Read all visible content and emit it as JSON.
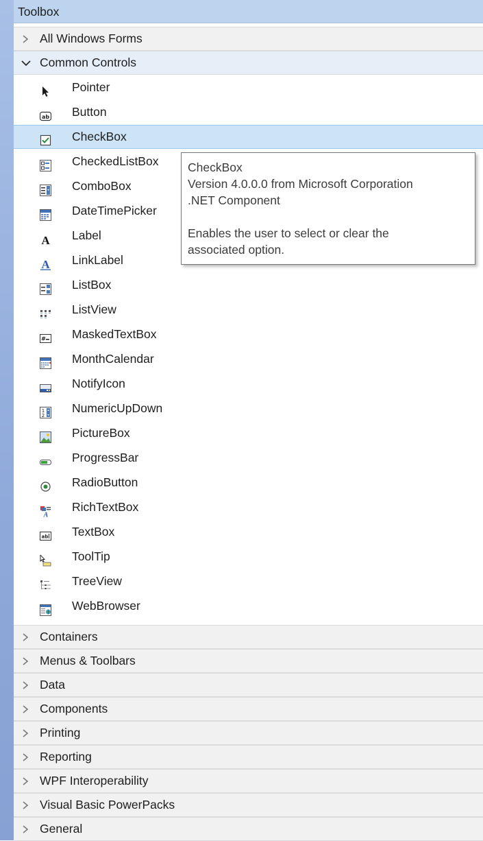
{
  "toolbox": {
    "title": "Toolbox",
    "categories_top": [
      {
        "label": "All Windows Forms",
        "expanded": false
      },
      {
        "label": "Common Controls",
        "expanded": true
      }
    ],
    "common_controls": [
      {
        "label": "Pointer",
        "icon": "pointer-icon"
      },
      {
        "label": "Button",
        "icon": "button-icon"
      },
      {
        "label": "CheckBox",
        "icon": "checkbox-icon",
        "selected": true
      },
      {
        "label": "CheckedListBox",
        "icon": "checkedlistbox-icon"
      },
      {
        "label": "ComboBox",
        "icon": "combobox-icon"
      },
      {
        "label": "DateTimePicker",
        "icon": "datetimepicker-icon"
      },
      {
        "label": "Label",
        "icon": "label-icon"
      },
      {
        "label": "LinkLabel",
        "icon": "linklabel-icon"
      },
      {
        "label": "ListBox",
        "icon": "listbox-icon"
      },
      {
        "label": "ListView",
        "icon": "listview-icon"
      },
      {
        "label": "MaskedTextBox",
        "icon": "maskedtextbox-icon"
      },
      {
        "label": "MonthCalendar",
        "icon": "monthcalendar-icon"
      },
      {
        "label": "NotifyIcon",
        "icon": "notifyicon-icon"
      },
      {
        "label": "NumericUpDown",
        "icon": "numericupdown-icon"
      },
      {
        "label": "PictureBox",
        "icon": "picturebox-icon"
      },
      {
        "label": "ProgressBar",
        "icon": "progressbar-icon"
      },
      {
        "label": "RadioButton",
        "icon": "radiobutton-icon"
      },
      {
        "label": "RichTextBox",
        "icon": "richtextbox-icon"
      },
      {
        "label": "TextBox",
        "icon": "textbox-icon"
      },
      {
        "label": "ToolTip",
        "icon": "tooltip-icon"
      },
      {
        "label": "TreeView",
        "icon": "treeview-icon"
      },
      {
        "label": "WebBrowser",
        "icon": "webbrowser-icon"
      }
    ],
    "categories_bottom": [
      {
        "label": "Containers"
      },
      {
        "label": "Menus & Toolbars"
      },
      {
        "label": "Data"
      },
      {
        "label": "Components"
      },
      {
        "label": "Printing"
      },
      {
        "label": "Reporting"
      },
      {
        "label": "WPF Interoperability"
      },
      {
        "label": "Visual Basic PowerPacks"
      },
      {
        "label": "General"
      }
    ]
  },
  "tooltip": {
    "line1": "CheckBox",
    "line2": "Version 4.0.0.0 from Microsoft Corporation",
    "line3": ".NET Component",
    "line4": "Enables the user to select or clear the",
    "line5": "associated option."
  },
  "colors": {
    "title_bar": "#bdd4ee",
    "selected_item": "#cde4f7",
    "left_strip": "#8fa9da"
  }
}
